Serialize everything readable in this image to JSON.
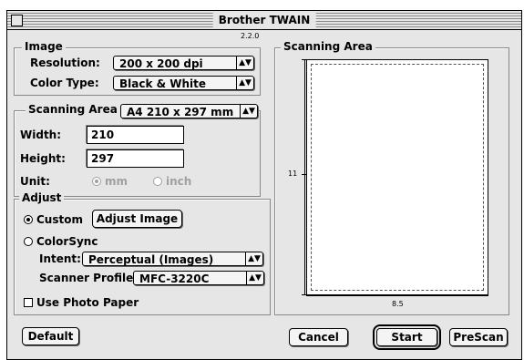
{
  "window": {
    "title": "Brother TWAIN",
    "version": "2.2.0"
  },
  "image": {
    "group_label": "Image",
    "resolution_label": "Resolution:",
    "resolution_value": "200 x 200 dpi",
    "color_type_label": "Color Type:",
    "color_type_value": "Black & White"
  },
  "scan_area": {
    "group_label": "Scanning Area",
    "size_value": "A4 210 x 297 mm",
    "width_label": "Width:",
    "width_value": "210",
    "height_label": "Height:",
    "height_value": "297",
    "unit_label": "Unit:",
    "unit_mm": "mm",
    "unit_inch": "inch"
  },
  "adjust": {
    "group_label": "Adjust",
    "custom_label": "Custom",
    "adjust_image_button": "Adjust Image",
    "colorsync_label": "ColorSync",
    "intent_label": "Intent:",
    "intent_value": "Perceptual (Images)",
    "scanner_profile_label": "Scanner Profile:",
    "scanner_profile_value": "MFC-3220C",
    "photo_paper_label": "Use Photo Paper"
  },
  "preview": {
    "group_label": "Scanning Area",
    "height_label": "11",
    "width_label": "8.5"
  },
  "buttons": {
    "default": "Default",
    "cancel": "Cancel",
    "start": "Start",
    "prescan": "PreScan"
  },
  "icons": {
    "popup_arrow": "updown-arrows-icon"
  }
}
